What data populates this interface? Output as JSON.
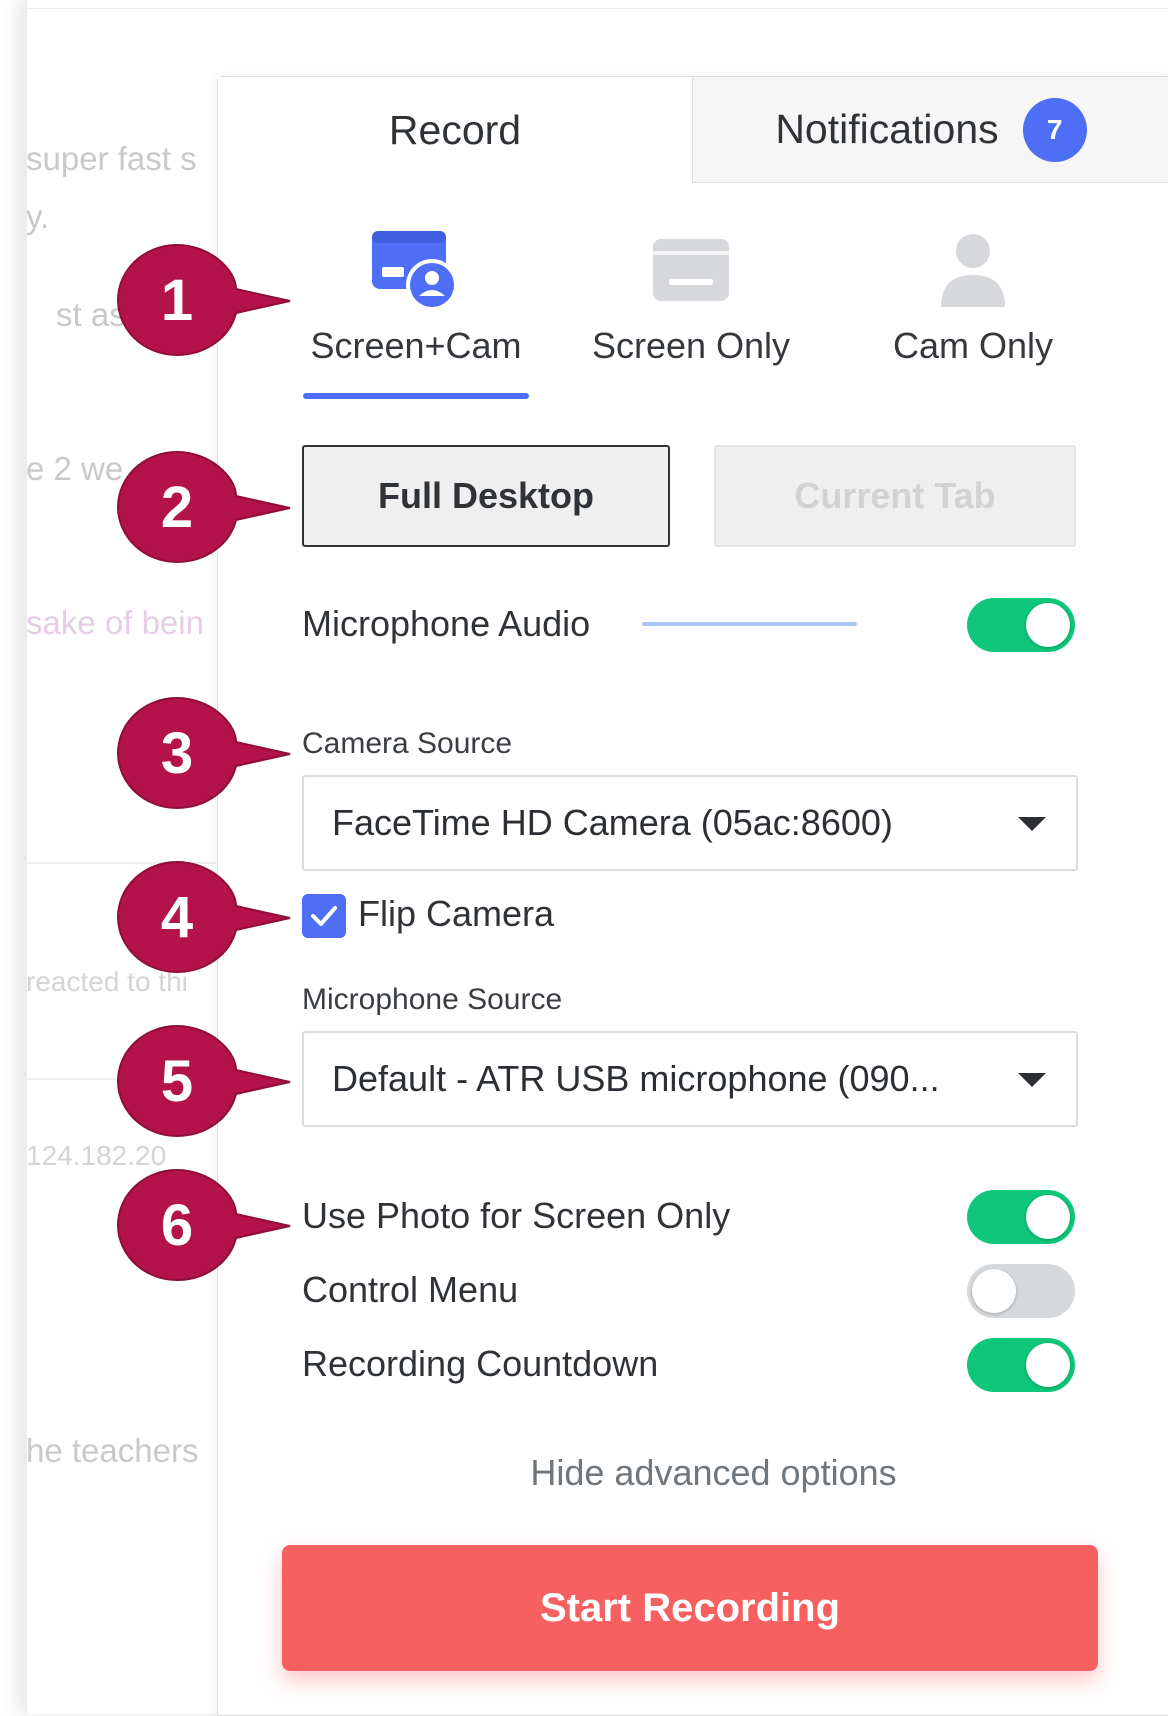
{
  "background": {
    "fragments": [
      "super fast s",
      "y.",
      "st ass",
      "e 2 we",
      "sake of bein",
      "reacted to thi",
      "124.182.20",
      "he teachers"
    ]
  },
  "tabs": {
    "record": "Record",
    "notifications": "Notifications",
    "notifications_badge": "7"
  },
  "modes": [
    {
      "label": "Screen+Cam",
      "icon": "screen-cam-icon",
      "selected": true
    },
    {
      "label": "Screen Only",
      "icon": "screen-icon",
      "selected": false
    },
    {
      "label": "Cam Only",
      "icon": "person-icon",
      "selected": false
    }
  ],
  "capture_area": {
    "full_desktop": "Full Desktop",
    "current_tab": "Current Tab",
    "selected": "Full Desktop"
  },
  "microphone_audio": {
    "label": "Microphone Audio",
    "enabled": true
  },
  "camera_source": {
    "label": "Camera Source",
    "value": "FaceTime HD Camera (05ac:8600)"
  },
  "flip_camera": {
    "label": "Flip Camera",
    "checked": true
  },
  "microphone_source": {
    "label": "Microphone Source",
    "value": "Default - ATR USB microphone (090..."
  },
  "settings": [
    {
      "label": "Use Photo for Screen Only",
      "enabled": true
    },
    {
      "label": "Control Menu",
      "enabled": false
    },
    {
      "label": "Recording Countdown",
      "enabled": true
    }
  ],
  "hide_advanced": "Hide advanced options",
  "start_button": "Start Recording",
  "callouts": [
    "1",
    "2",
    "3",
    "4",
    "5",
    "6"
  ],
  "colors": {
    "accent": "#4d6ef5",
    "toggle_on": "#0ec77a",
    "start_button": "#f76060",
    "callout": "#b3134a"
  }
}
